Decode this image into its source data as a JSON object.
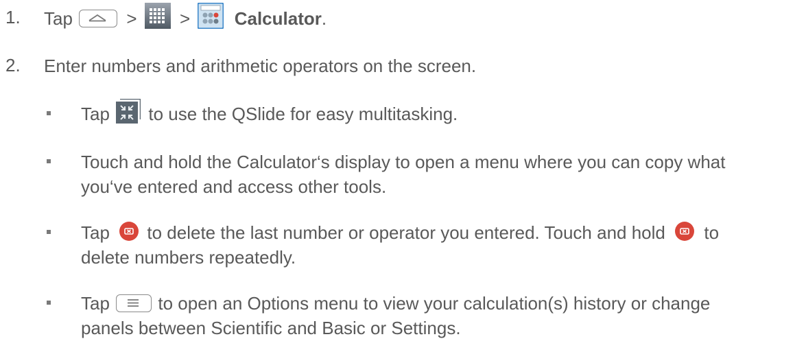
{
  "steps": [
    {
      "number": "1.",
      "tap": "Tap",
      "sep1": ">",
      "sep2": ">",
      "app_name": "Calculator",
      "end": ".",
      "icons": [
        "home-key-icon",
        "apps-grid-icon",
        "calculator-app-icon"
      ]
    },
    {
      "number": "2.",
      "text": "Enter numbers and arithmetic operators on the screen."
    }
  ],
  "bullets": [
    {
      "tap": "Tap",
      "icon": "qslide-icon",
      "text": "to use the QSlide for easy multitasking."
    },
    {
      "line1": "Touch and hold the Calculator‘s display to open a menu where you can copy what",
      "line2": "you‘ve entered and access other tools."
    },
    {
      "tap": "Tap",
      "icon": "delete-icon",
      "text_a": "to delete the last number or operator you entered. Touch and hold",
      "text_b": "to",
      "line2": "delete numbers repeatedly."
    },
    {
      "tap": "Tap",
      "icon": "menu-key-icon",
      "text": "to open an Options menu to view your calculation(s) history or change",
      "line2": "panels between Scientific and Basic or Settings."
    }
  ],
  "colors": {
    "text": "#595959",
    "delete_icon": "#d9463a",
    "calculator_icon_border": "#3a86c9"
  }
}
